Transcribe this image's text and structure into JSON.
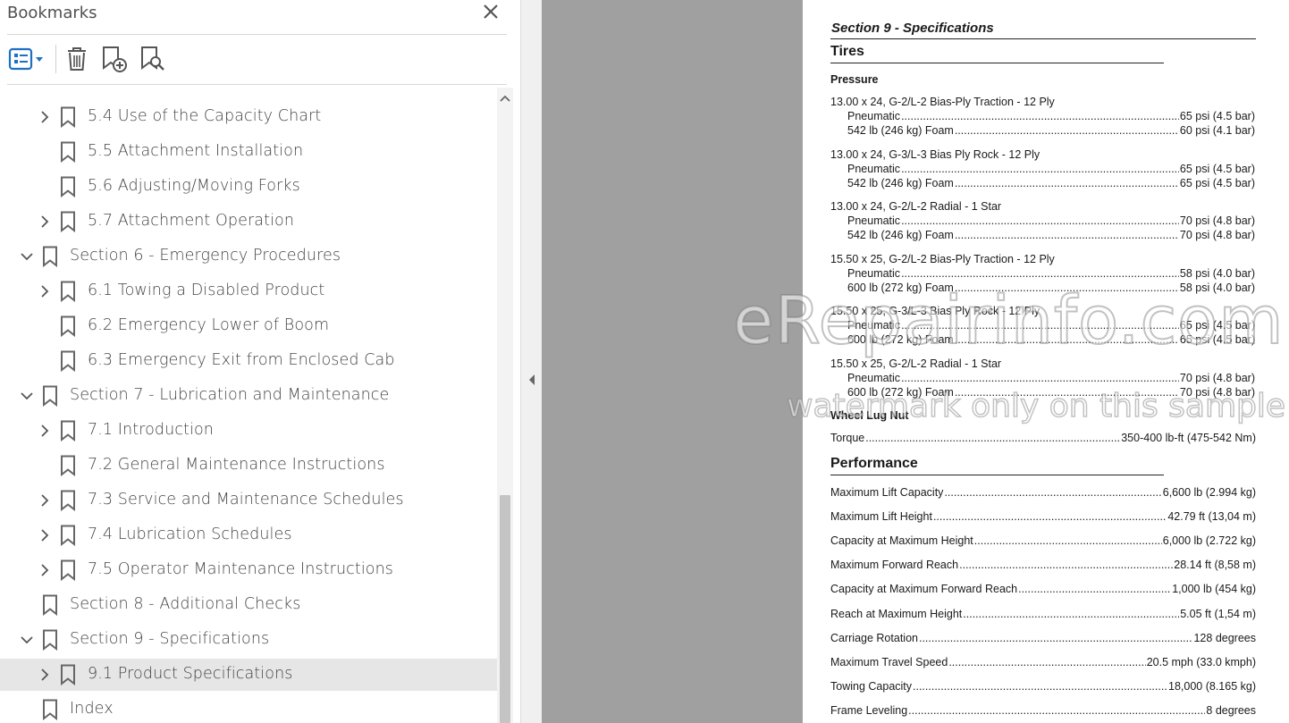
{
  "panel": {
    "title": "Bookmarks",
    "close_icon": "close-icon",
    "toolbar": [
      {
        "name": "options-menu-button",
        "icon": "list-options-icon"
      },
      {
        "name": "delete-bookmark-button",
        "icon": "trash-icon"
      },
      {
        "name": "new-bookmark-button",
        "icon": "bookmark-add-icon"
      },
      {
        "name": "find-bookmark-button",
        "icon": "bookmark-search-icon"
      }
    ],
    "items": [
      {
        "label": "5.4 Use of the Capacity Chart",
        "level": 1,
        "expander": "collapsed"
      },
      {
        "label": "5.5 Attachment Installation",
        "level": 1,
        "expander": "none"
      },
      {
        "label": "5.6 Adjusting/Moving Forks",
        "level": 1,
        "expander": "none"
      },
      {
        "label": "5.7 Attachment Operation",
        "level": 1,
        "expander": "collapsed"
      },
      {
        "label": "Section 6 - Emergency Procedures",
        "level": 0,
        "expander": "expanded"
      },
      {
        "label": "6.1 Towing a Disabled Product",
        "level": 1,
        "expander": "collapsed"
      },
      {
        "label": "6.2 Emergency Lower of Boom",
        "level": 1,
        "expander": "none"
      },
      {
        "label": "6.3 Emergency Exit from Enclosed Cab",
        "level": 1,
        "expander": "none"
      },
      {
        "label": "Section 7 - Lubrication and Maintenance",
        "level": 0,
        "expander": "expanded"
      },
      {
        "label": "7.1 Introduction",
        "level": 1,
        "expander": "collapsed"
      },
      {
        "label": "7.2 General Maintenance Instructions",
        "level": 1,
        "expander": "none"
      },
      {
        "label": "7.3 Service and Maintenance Schedules",
        "level": 1,
        "expander": "collapsed"
      },
      {
        "label": "7.4 Lubrication Schedules",
        "level": 1,
        "expander": "collapsed"
      },
      {
        "label": "7.5 Operator Maintenance Instructions",
        "level": 1,
        "expander": "collapsed"
      },
      {
        "label": "Section 8 - Additional Checks",
        "level": 0,
        "expander": "none"
      },
      {
        "label": "Section 9 - Specifications",
        "level": 0,
        "expander": "expanded"
      },
      {
        "label": "9.1 Product Specifications",
        "level": 1,
        "expander": "collapsed",
        "selected": true
      },
      {
        "label": "Index",
        "level": 0,
        "expander": "none"
      }
    ]
  },
  "document": {
    "section_heading": "Section 9 - Specifications",
    "tires": {
      "heading": "Tires",
      "pressure_heading": "Pressure",
      "groups": [
        {
          "title": "13.00 x 24, G-2/L-2 Bias-Ply Traction - 12 Ply",
          "rows": [
            {
              "k": "Pneumatic",
              "v": "65 psi (4.5 bar)"
            },
            {
              "k": "542 lb (246 kg) Foam",
              "v": "60 psi (4.1 bar)"
            }
          ]
        },
        {
          "title": "13.00 x 24, G-3/L-3 Bias Ply Rock - 12 Ply",
          "rows": [
            {
              "k": "Pneumatic",
              "v": "65 psi (4.5 bar)"
            },
            {
              "k": "542 lb (246 kg) Foam",
              "v": "65 psi (4.5 bar)"
            }
          ]
        },
        {
          "title": "13.00 x 24, G-2/L-2 Radial - 1 Star",
          "rows": [
            {
              "k": "Pneumatic",
              "v": "70 psi (4.8 bar)"
            },
            {
              "k": "542 lb (246 kg) Foam",
              "v": "70 psi (4.8 bar)"
            }
          ]
        },
        {
          "title": "15.50 x 25, G-2/L-2 Bias-Ply Traction - 12 Ply",
          "rows": [
            {
              "k": "Pneumatic",
              "v": "58 psi (4.0 bar)"
            },
            {
              "k": "600 lb (272 kg) Foam",
              "v": "58 psi (4.0 bar)"
            }
          ]
        },
        {
          "title": "15.50 x 25, G-3/L-3 Bias Ply Rock - 12 Ply",
          "rows": [
            {
              "k": "Pneumatic",
              "v": "65 psi (4.5 bar)"
            },
            {
              "k": "600 lb (272 kg) Foam",
              "v": "65 psi (4.5 bar)"
            }
          ]
        },
        {
          "title": "15.50 x 25, G-2/L-2 Radial - 1 Star",
          "rows": [
            {
              "k": "Pneumatic",
              "v": "70 psi (4.8 bar)"
            },
            {
              "k": "600 lb (272 kg) Foam",
              "v": "70 psi (4.8 bar)"
            }
          ]
        }
      ],
      "lug_heading": "Wheel Lug Nut",
      "torque": {
        "k": "Torque",
        "v": "350-400 lb-ft (475-542 Nm)"
      }
    },
    "performance": {
      "heading": "Performance",
      "rows": [
        {
          "k": "Maximum Lift Capacity",
          "v": "6,600 lb (2.994 kg)"
        },
        {
          "k": "Maximum Lift Height",
          "v": "42.79 ft (13,04 m)"
        },
        {
          "k": "Capacity at Maximum Height",
          "v": "6,000 lb (2.722 kg)"
        },
        {
          "k": "Maximum Forward Reach",
          "v": "28.14 ft (8,58 m)"
        },
        {
          "k": "Capacity at Maximum Forward Reach",
          "v": "1,000 lb (454 kg)"
        },
        {
          "k": "Reach at Maximum Height",
          "v": "5.05 ft (1,54 m)"
        },
        {
          "k": "Carriage Rotation",
          "v": "128 degrees"
        },
        {
          "k": "Maximum Travel Speed",
          "v": "20.5 mph (33.0 kmph)"
        },
        {
          "k": "Towing Capacity",
          "v": "18,000 (8.165 kg)"
        },
        {
          "k": "Frame Leveling",
          "v": "8 degrees"
        }
      ]
    },
    "watermark": {
      "line1": "eRepairinfo.com",
      "line2": "watermark only on this sample"
    }
  }
}
